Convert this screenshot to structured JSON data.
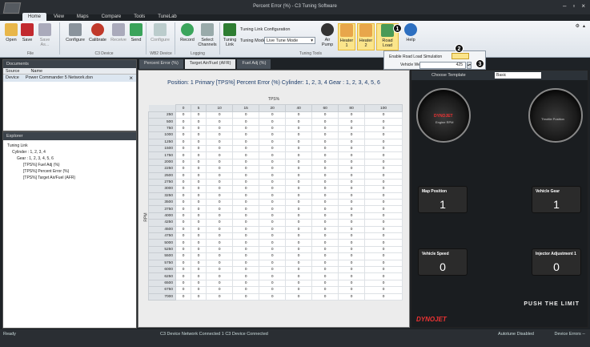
{
  "window": {
    "title": "Percent Error (%) - C3 Tuning Software"
  },
  "ribbon_tabs": [
    "Home",
    "View",
    "Maps",
    "Compare",
    "Tools",
    "TuneLab"
  ],
  "ribbon": {
    "file_buttons": [
      "Open",
      "Save",
      "Save As...",
      "Configure",
      "Calibrate",
      "Receive",
      "Send"
    ],
    "groups": {
      "file": "File",
      "c3device": "C3 Device",
      "wb2": "WB2 Device",
      "logging": "Logging",
      "tuning": "Tuning Tools"
    },
    "configure2": "Configure",
    "record": "Record",
    "select_channels": "Select Channels",
    "tuning_link": "Tuning Link",
    "tuning_link_config": "Tuning Link Configuration",
    "tuning_mode_label": "Tuning Mode:",
    "tuning_mode_value": "Live Tune Mode",
    "air_pump": "Air Pump",
    "heater1": "Heater 1",
    "heater2": "Heater 2",
    "road_load": "Road Load",
    "help": "Help"
  },
  "popup": {
    "enable_label": "Enable Road Load Simulation",
    "weight_label": "Vehicle Weight",
    "weight_value": "425",
    "markers": [
      "1",
      "2",
      "3"
    ]
  },
  "documents_panel": {
    "title": "Documents",
    "columns": [
      "Source",
      "Name"
    ],
    "row": {
      "source": "Device",
      "name": "Power Commander 5 Network.dsn"
    }
  },
  "explorer_panel": {
    "title": "Explorer",
    "items": [
      "Tuning Link",
      "Cylinder : 1, 2, 3, 4",
      "Gear : 1, 2, 3, 4, 5, 6",
      "[TPS%] Fuel Adj (%)",
      "[TPS%] Percent Error (%)",
      "[TPS%] Target Air/Fuel (AFR)"
    ]
  },
  "doc_tabs": [
    "Percent Error (%)",
    "Target Air/Fuel (AFR)",
    "Fuel Adj (%)"
  ],
  "map": {
    "position_text": "Position: 1  Primary  [TPS%] Percent Error (%)  Cylinder: 1, 2, 3, 4  Gear : 1, 2, 3, 4, 5, 6",
    "tps_label": "TPS%",
    "rpm_label": "RPM",
    "tps_cols": [
      "0",
      "5",
      "10",
      "15",
      "20",
      "40",
      "60",
      "80",
      "100"
    ],
    "rpm_rows": [
      "250",
      "500",
      "750",
      "1000",
      "1250",
      "1500",
      "1750",
      "2000",
      "2250",
      "2500",
      "2750",
      "3000",
      "3250",
      "3500",
      "3750",
      "4000",
      "4250",
      "4500",
      "4750",
      "5000",
      "5250",
      "5500",
      "5750",
      "6000",
      "6250",
      "6500",
      "6750",
      "7000"
    ],
    "cell_value": "0"
  },
  "dash": {
    "choose_template": "Choose Template",
    "template_value": "Basic",
    "gauge_left": {
      "brand": "DYNOJET",
      "label": "Engine RPM"
    },
    "gauge_right": {
      "label": "Throttle Position"
    },
    "tiles": [
      {
        "title": "Map Position",
        "value": "1"
      },
      {
        "title": "Vehicle Gear",
        "value": "1"
      },
      {
        "title": "Vehicle Speed",
        "value": "0"
      },
      {
        "title": "Injector Adjustment 1",
        "value": "0"
      }
    ],
    "slogan": "PUSH THE LIMIT",
    "logo": "DYNOJET"
  },
  "status": {
    "left": "Ready",
    "center": "C3 Device Network Connected   1 C3 Device Connected",
    "autotune": "Autotune Disabled",
    "device_errors": "Device Errors --"
  },
  "colors": {
    "accent": "#2d5fa0",
    "highlight": "#fbe58b",
    "dark": "#1e2226"
  }
}
